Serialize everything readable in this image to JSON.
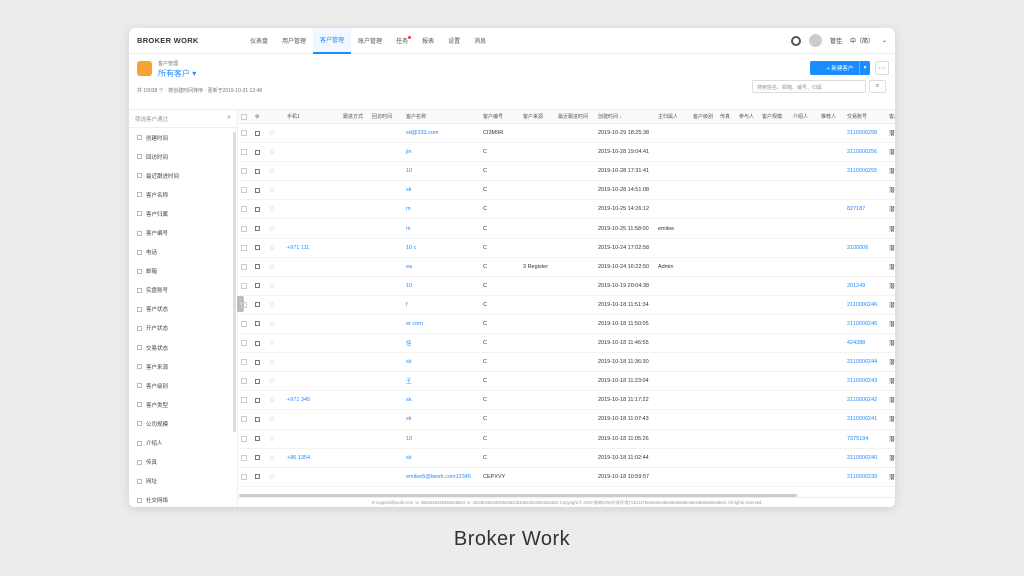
{
  "app": {
    "brand": "BROKER WORK",
    "caption": "Broker Work"
  },
  "nav": [
    "仪表盘",
    "用户管理",
    "客户管理",
    "账户管理",
    "任务",
    "报表",
    "设置",
    "消息"
  ],
  "user": {
    "name": "管佳",
    "lang": "中（简）"
  },
  "sub": {
    "crumb": "客户管理",
    "view": "所有客户",
    "meta": "共 10038 个 · 按创建时间排序 · 更新于2019-10-31 12:48",
    "new_label": "+ 新建客户",
    "more": "···",
    "search_placeholder": "搜索姓名、邮箱、编号、归属"
  },
  "side": {
    "search_placeholder": "筛选客户通过",
    "filters": [
      "创建时间",
      "回访时间",
      "最近跟进时间",
      "客户名称",
      "客户归属",
      "客户编号",
      "电话",
      "邮箱",
      "实盘账号",
      "客户状态",
      "开户状态",
      "交易状态",
      "客户来源",
      "客户级别",
      "客户类型",
      "公司规模",
      "介绍人",
      "传真",
      "网址",
      "社交网络"
    ]
  },
  "headers": [
    "",
    "",
    "",
    "手机1",
    "跟进方式",
    "回访时间",
    "客户名称",
    "客户编号",
    "客户来源",
    "最近跟进时间",
    "创建时间 ↓",
    "主归属人",
    "客户级别",
    "传真",
    "参与人",
    "客户规模",
    "介绍人",
    "推荐人",
    "交易账号",
    "客户状"
  ],
  "rows": [
    {
      "phone": "",
      "name": "sd@333.com",
      "id": "CI3M9R",
      "src": "",
      "created": "2019-10-29 18:25:38",
      "owner": "",
      "acct": "2110000258",
      "status": "潜在客"
    },
    {
      "phone": "",
      "name": "jin",
      "id": "C",
      "src": "",
      "created": "2019-10-28 19:04:41",
      "owner": "",
      "acct": "2110000256",
      "status": "潜在客"
    },
    {
      "phone": "",
      "name": "10",
      "id": "C",
      "src": "",
      "created": "2019-10-28 17:31:41",
      "owner": "",
      "acct": "2110000255",
      "status": "潜在客"
    },
    {
      "phone": "",
      "name": "sk",
      "id": "C",
      "src": "",
      "created": "2019-10-28 14:51:08",
      "owner": "",
      "acct": "",
      "status": "潜在客"
    },
    {
      "phone": "",
      "name": "m",
      "id": "C",
      "src": "",
      "created": "2019-10-25 14:26:12",
      "owner": "",
      "acct": "827187",
      "status": "潜在客"
    },
    {
      "phone": "",
      "name": "m",
      "id": "C",
      "src": "",
      "created": "2019-10-25 11:58:00",
      "owner": "emilee",
      "acct": "",
      "status": "潜在客"
    },
    {
      "phone": "+971 111",
      "name": "10                  c",
      "id": "C",
      "src": "",
      "created": "2019-10-24 17:02:58",
      "owner": "",
      "acct": "2100006",
      "status": "潜在客"
    },
    {
      "phone": "",
      "name": "ea",
      "id": "C",
      "src": "3 Register",
      "created": "2019-10-24 16:22:50",
      "owner": "Admin",
      "acct": "",
      "status": "潜在客"
    },
    {
      "phone": "",
      "name": "10",
      "id": "C",
      "src": "",
      "created": "2019-10-19 20:04:38",
      "owner": "",
      "acct": "201249",
      "status": "潜在客"
    },
    {
      "phone": "",
      "name": "f",
      "id": "C",
      "src": "",
      "created": "2019-10-18 11:51:34",
      "owner": "",
      "acct": "2110000246",
      "status": "潜在客"
    },
    {
      "phone": "",
      "name": "er                   com",
      "id": "C",
      "src": "",
      "created": "2019-10-18 11:50:05",
      "owner": "",
      "acct": "2110000245",
      "status": "潜在客"
    },
    {
      "phone": "",
      "name": "佳",
      "id": "C",
      "src": "",
      "created": "2019-10-18 11:46:55",
      "owner": "",
      "acct": "424388",
      "status": "潜在客"
    },
    {
      "phone": "",
      "name": "sk",
      "id": "C",
      "src": "",
      "created": "2019-10-18 11:36:30",
      "owner": "",
      "acct": "2110000244",
      "status": "潜在客"
    },
    {
      "phone": "",
      "name": "王",
      "id": "C",
      "src": "",
      "created": "2019-10-18 11:23:04",
      "owner": "",
      "acct": "2110000243",
      "status": "潜在客"
    },
    {
      "phone": "+971 345",
      "name": "sk",
      "id": "C",
      "src": "",
      "created": "2019-10-18 11:17:22",
      "owner": "",
      "acct": "2110000242",
      "status": "潜在客"
    },
    {
      "phone": "",
      "name": "sk",
      "id": "C",
      "src": "",
      "created": "2019-10-18 11:07:43",
      "owner": "",
      "acct": "2110000241",
      "status": "潜在客"
    },
    {
      "phone": "",
      "name": "10",
      "id": "C",
      "src": "",
      "created": "2019-10-18 11:05:26",
      "owner": "",
      "acct": "7375194",
      "status": "潜在客"
    },
    {
      "phone": "+86 1354",
      "name": "sk",
      "id": "C",
      "src": "",
      "created": "2019-10-18 11:02:44",
      "owner": "",
      "acct": "2110000240",
      "status": "潜在客"
    },
    {
      "phone": "",
      "name": "emilee5@lwork.com12345",
      "id": "CEPXVY",
      "src": "",
      "created": "2019-10-18 10:59:57",
      "owner": "",
      "acct": "2110000239",
      "status": "潜在客"
    }
  ],
  "footer": "✉ support@lwork.com  ☏ 4563456345456345634  ☏ 4034534534534534534534534534534534534  Copyright © 2019 券商CRM开发环境TS01117testtesttesttesttesttesttesttesttesttesttesttest. All rights reserved.",
  "colors": {
    "accent": "#1a8cff",
    "star": "#f7a233"
  }
}
